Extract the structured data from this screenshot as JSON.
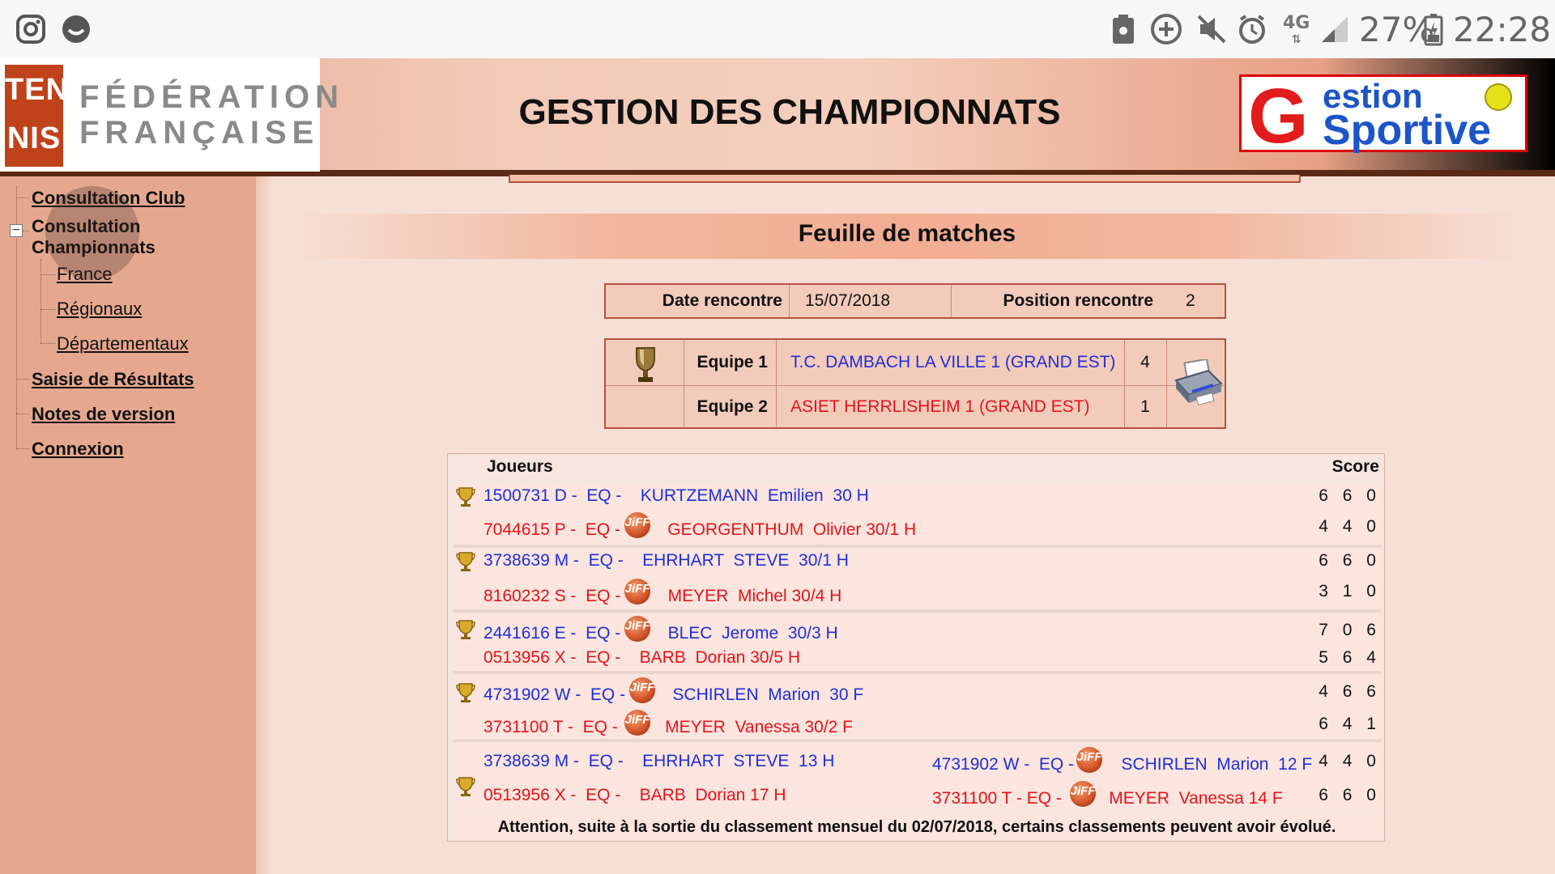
{
  "status_bar": {
    "battery": "27%",
    "time": "22:28",
    "network": "4G"
  },
  "header": {
    "fft_line1": "TEN",
    "fft_line2": "NIS",
    "fft_word1": "FÉDÉRATION",
    "fft_word2": "FRANÇAISE",
    "title": "GESTION DES CHAMPIONNATS",
    "gs_g": "G",
    "gs_top": "estion",
    "gs_bottom": "Sportive",
    "gs_e": "e"
  },
  "sidebar": {
    "items": [
      {
        "label": "Consultation Club"
      },
      {
        "label": "Consultation Championnats",
        "line1": "Consultation",
        "line2": "Championnats"
      },
      {
        "label": "France"
      },
      {
        "label": "Régionaux"
      },
      {
        "label": "Départementaux"
      },
      {
        "label": "Saisie de Résultats"
      },
      {
        "label": "Notes de version"
      },
      {
        "label": "Connexion"
      }
    ]
  },
  "main": {
    "section_title": "Feuille de matches",
    "date_label": "Date rencontre",
    "date_value": "15/07/2018",
    "position_label": "Position rencontre",
    "position_value": "2",
    "team1_label": "Equipe 1",
    "team1_name": "T.C. DAMBACH LA VILLE 1 (GRAND EST)",
    "team1_score": "4",
    "team2_label": "Equipe 2",
    "team2_name": "ASIET HERRLISHEIM 1 (GRAND EST)",
    "team2_score": "1",
    "players_header": "Joueurs",
    "score_header": "Score",
    "jiff_label": "JiFF",
    "matches": [
      {
        "p1": "1500731 D -  EQ -    KURTZEMANN  Emilien  30 H",
        "s1": "6 6 0",
        "p2": "7044615 P -  EQ -          GEORGENTHUM  Olivier 30/1 H",
        "s2": "4 4 0"
      },
      {
        "p1": "3738639 M -  EQ -    EHRHART  STEVE  30/1 H",
        "s1": "6 6 0",
        "p2": "8160232 S -  EQ -          MEYER  Michel 30/4 H",
        "s2": "3 1 0"
      },
      {
        "p1": "2441616 E -  EQ -          BLEC  Jerome  30/3 H",
        "s1": "7 0 6",
        "p2": "0513956 X -  EQ -    BARB  Dorian 30/5 H",
        "s2": "5 6 4"
      },
      {
        "p1": "4731902 W -  EQ -          SCHIRLEN  Marion  30 F",
        "s1": "4 6 6",
        "p2": "3731100 T -  EQ -          MEYER  Vanessa 30/2 F",
        "s2": "6 4 1"
      },
      {
        "p1": "3738639 M -  EQ -    EHRHART  STEVE  13 H",
        "p1b": "4731902 W -  EQ -          SCHIRLEN  Marion  12 F",
        "s1": "4 4 0",
        "p2": "0513956 X -  EQ -    BARB  Dorian 17 H",
        "p2b": "3731100 T - EQ -          MEYER  Vanessa 14 F",
        "s2": "6 6 0"
      }
    ],
    "notice": "Attention, suite à la sortie du classement mensuel du 02/07/2018, certains classements peuvent avoir évolué."
  },
  "colors": {
    "team1": "#1f2fd6",
    "team2": "#e0141c",
    "accent": "#b5523b",
    "sidebar": "#e5a88e"
  },
  "icons": [
    "instagram-icon",
    "chat-icon",
    "trophy-icon",
    "printer-icon",
    "jiff-badge-icon",
    "battery-icon",
    "alarm-icon",
    "mute-icon",
    "signal-icon"
  ]
}
